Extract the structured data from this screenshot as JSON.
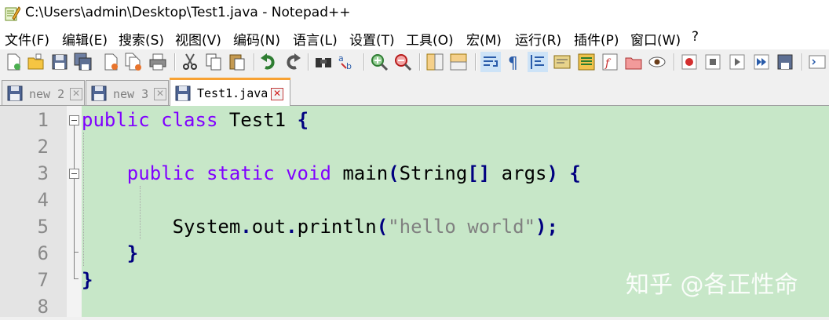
{
  "window": {
    "title": "C:\\Users\\admin\\Desktop\\Test1.java - Notepad++",
    "app_icon": "notepadpp-icon"
  },
  "menu": [
    {
      "label": "文件(F)"
    },
    {
      "label": "编辑(E)"
    },
    {
      "label": "搜索(S)"
    },
    {
      "label": "视图(V)"
    },
    {
      "label": "编码(N)"
    },
    {
      "label": "语言(L)"
    },
    {
      "label": "设置(T)"
    },
    {
      "label": "工具(O)"
    },
    {
      "label": "宏(M)"
    },
    {
      "label": "运行(R)"
    },
    {
      "label": "插件(P)"
    },
    {
      "label": "窗口(W)"
    },
    {
      "label": "?"
    }
  ],
  "toolbar": {
    "icons": [
      "new-file-icon",
      "open-file-icon",
      "save-icon",
      "save-all-icon",
      "close-icon",
      "close-all-icon",
      "print-icon",
      "cut-icon",
      "copy-icon",
      "paste-icon",
      "undo-icon",
      "redo-icon",
      "find-icon",
      "replace-icon",
      "zoom-in-icon",
      "zoom-out-icon",
      "sync-vertical-icon",
      "sync-horizontal-icon",
      "word-wrap-icon",
      "show-all-chars-icon",
      "indent-guide-icon",
      "udl-icon",
      "doc-map-icon",
      "function-list-icon",
      "folder-workspace-icon",
      "monitoring-icon",
      "record-macro-icon",
      "stop-macro-icon",
      "play-macro-icon",
      "run-macro-multiple-icon",
      "save-macro-icon",
      "extra-icon"
    ]
  },
  "tabs": [
    {
      "label": "new 2",
      "active": false
    },
    {
      "label": "new 3",
      "active": false
    },
    {
      "label": "Test1.java",
      "active": true
    }
  ],
  "editor": {
    "background": "#c7e7c8",
    "line_numbers": [
      "1",
      "2",
      "3",
      "4",
      "5",
      "6",
      "7",
      "8"
    ],
    "lines": {
      "l1": {
        "kw1": "public",
        "kw2": "class",
        "name": "Test1",
        "brace": "{"
      },
      "l3": {
        "kw1": "public",
        "kw2": "static",
        "kw3": "void",
        "name": "main",
        "open": "(",
        "type": "String",
        "brackets": "[]",
        "arg": "args",
        "close": ")",
        "brace": "{"
      },
      "l5": {
        "obj": "System",
        "dot1": ".",
        "field": "out",
        "dot2": ".",
        "method": "println",
        "open": "(",
        "string": "\"hello world\"",
        "close": ")",
        "semi": ";"
      },
      "l6": {
        "brace": "}"
      },
      "l7": {
        "brace": "}"
      }
    }
  },
  "watermark": "知乎 @各正性命"
}
